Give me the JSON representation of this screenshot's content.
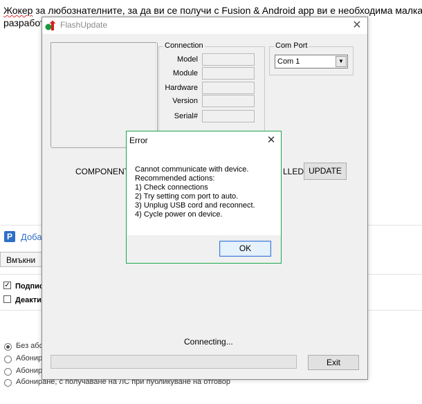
{
  "background": {
    "line1_word": "Жокер",
    "line1_rest": " за любознателните, за да ви се получи с Fusion & Android app ви е необходима малка",
    "line2": "разработ",
    "link": "Доба",
    "insert_button": "Вмъкни",
    "checkbox1_label": "Подпис",
    "checkbox2_label": "Деакти",
    "radio1": "Без або",
    "radio2": "Абонир",
    "radio3": "Абонир",
    "radio4": "Абониране, с получаване на ЛС при публикуване на отговор"
  },
  "window": {
    "title": "FlashUpdate",
    "close": "✕",
    "connection": {
      "label": "Connection",
      "fields": [
        "Model",
        "Module",
        "Hardware",
        "Version",
        "Serial#"
      ]
    },
    "com_port": {
      "label": "Com Port",
      "selected": "Com 1"
    },
    "component_label": "COMPONENT",
    "installed_label": "LLED",
    "update_button": "UPDATE",
    "status": "Connecting...",
    "exit_button": "Exit"
  },
  "error_dialog": {
    "title": "Error",
    "close": "✕",
    "message": "Cannot communicate with device.\nRecommended actions:\n1) Check connections\n2) Try setting com port to auto.\n3) Unplug USB cord and reconnect.\n4) Cycle power on device.",
    "ok_button": "OK"
  },
  "colors": {
    "dialog_border": "#1aa64a",
    "link": "#2f6fc7"
  },
  "icons": {
    "app": "green-dot-red-arrow-icon",
    "logo": "p-logo-icon",
    "dropdown": "chevron-down-icon",
    "close": "close-icon"
  }
}
